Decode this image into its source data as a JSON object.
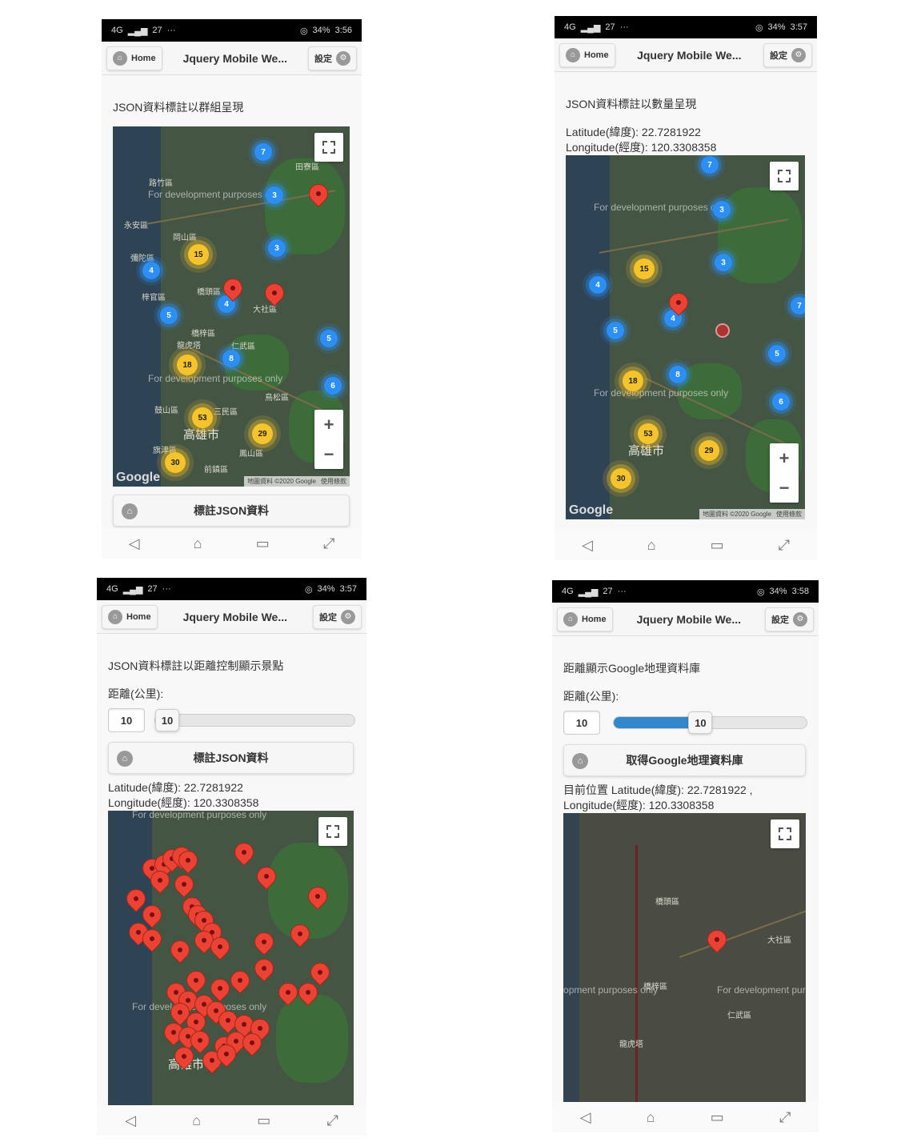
{
  "phones": [
    {
      "status": {
        "signal": "4G",
        "carrier": "27",
        "dots": "···",
        "battery": "34%",
        "time": "3:56"
      },
      "header": {
        "home_label": "Home",
        "title": "Jquery Mobile We...",
        "settings_label": "設定"
      },
      "page_title": "JSON資料標註以群組呈現",
      "map": {
        "watermark": "For development purposes only",
        "labels": [
          "田寮區",
          "路竹區",
          "永安區",
          "岡山區",
          "彌陀區",
          "梓官區",
          "橋頭區",
          "大社區",
          "橋梓區",
          "龍虎塔",
          "仁武區",
          "鳥松區",
          "鼓山區",
          "三民區",
          "旗津區",
          "鳳山區",
          "前鎮區"
        ],
        "city": "高雄市",
        "attribution": "地圖資料 ©2020 Google",
        "terms": "使用條款",
        "clusters_yellow": [
          "15",
          "18",
          "53",
          "29",
          "30"
        ],
        "clusters_blue": [
          "7",
          "3",
          "3",
          "4",
          "5",
          "4",
          "8",
          "5",
          "6"
        ]
      },
      "button_label": "標註JSON資料"
    },
    {
      "status": {
        "signal": "4G",
        "carrier": "27",
        "dots": "···",
        "battery": "34%",
        "time": "3:57"
      },
      "header": {
        "home_label": "Home",
        "title": "Jquery Mobile We...",
        "settings_label": "設定"
      },
      "page_title": "JSON資料標註以數量呈現",
      "latitude": "Latitude(緯度): 22.7281922",
      "longitude": "Longitude(經度): 120.3308358",
      "map": {
        "watermark": "For development purposes only",
        "city": "高雄市",
        "attribution": "地圖資料 ©2020 Google",
        "terms": "使用條款",
        "clusters_yellow": [
          "15",
          "18",
          "53",
          "29",
          "30"
        ],
        "clusters_blue": [
          "7",
          "3",
          "3",
          "4",
          "4",
          "5",
          "8",
          "5",
          "6",
          "7"
        ]
      }
    },
    {
      "status": {
        "signal": "4G",
        "carrier": "27",
        "dots": "···",
        "battery": "34%",
        "time": "3:57"
      },
      "header": {
        "home_label": "Home",
        "title": "Jquery Mobile We...",
        "settings_label": "設定"
      },
      "page_title": "JSON資料標註以距離控制顯示景點",
      "distance_label": "距離(公里):",
      "distance_value": "10",
      "button_label": "標註JSON資料",
      "latitude": "Latitude(緯度): 22.7281922",
      "longitude": "Longitude(經度): 120.3308358",
      "map": {
        "watermark": "For development purposes only",
        "city": "高雄市"
      }
    },
    {
      "status": {
        "signal": "4G",
        "carrier": "27",
        "dots": "···",
        "battery": "34%",
        "time": "3:58"
      },
      "header": {
        "home_label": "Home",
        "title": "Jquery Mobile We...",
        "settings_label": "設定"
      },
      "page_title": "距離顯示Google地理資料庫",
      "distance_label": "距離(公里):",
      "distance_value": "10",
      "slider_fraction": 0.45,
      "button_label": "取得Google地理資料庫",
      "position_line1": "目前位置 Latitude(緯度): 22.7281922 ,",
      "position_line2": "Longitude(經度): 120.3308358",
      "map": {
        "watermark": "For development purposes only",
        "labels": [
          "橋頭區",
          "大社區",
          "仁武區",
          "龍虎塔",
          "橋梓區"
        ]
      }
    }
  ],
  "nav": {
    "back": "◁",
    "home": "⌂",
    "recent": "▭",
    "extra": "⤢"
  },
  "colors": {
    "marker_red": "#ea4335",
    "cluster_yellow": "#f5c32c",
    "cluster_blue": "#2b8ff5",
    "slider_fill": "#3388cc"
  }
}
